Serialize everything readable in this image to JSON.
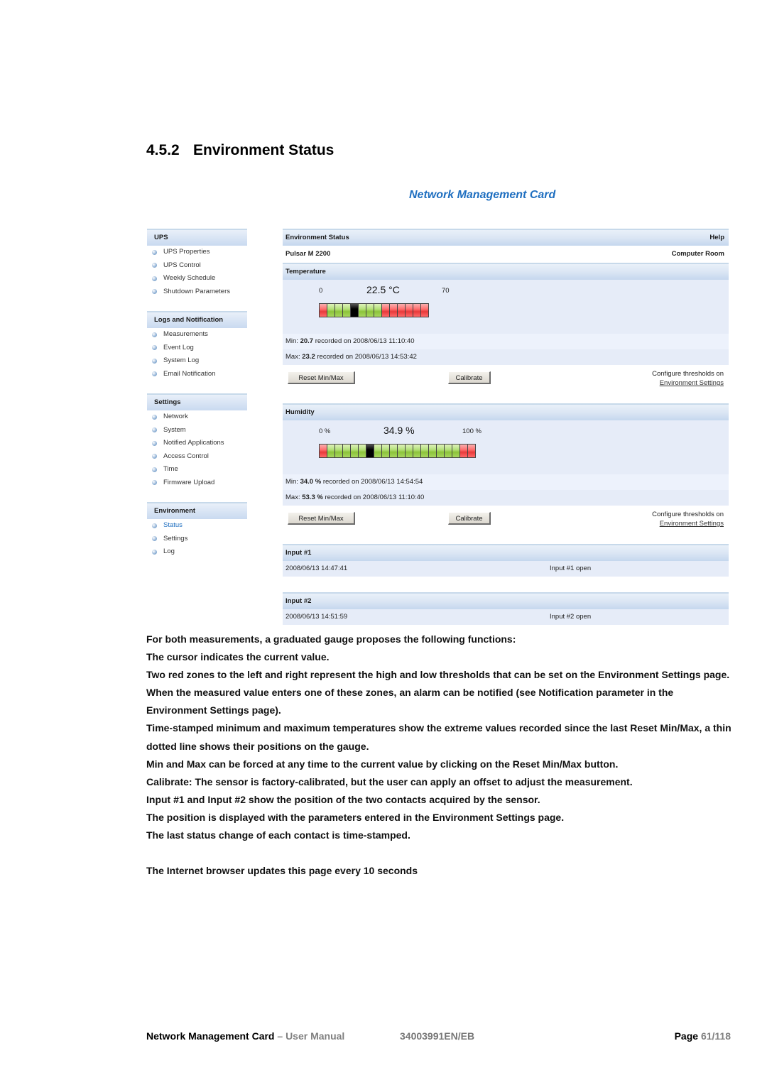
{
  "document": {
    "section_number": "4.5.2",
    "section_title": "Environment Status"
  },
  "screenshot": {
    "app_title": "Network Management Card",
    "sidebar": {
      "groups": [
        {
          "title": "UPS",
          "items": [
            "UPS Properties",
            "UPS Control",
            "Weekly Schedule",
            "Shutdown Parameters"
          ]
        },
        {
          "title": "Logs and Notification",
          "items": [
            "Measurements",
            "Event Log",
            "System Log",
            "Email Notification"
          ]
        },
        {
          "title": "Settings",
          "items": [
            "Network",
            "System",
            "Notified Applications",
            "Access Control",
            "Time",
            "Firmware Upload"
          ]
        },
        {
          "title": "Environment",
          "items": [
            "Status",
            "Settings",
            "Log"
          ],
          "active_item": "Status"
        }
      ]
    },
    "main": {
      "header_title": "Environment Status",
      "help_label": "Help",
      "device_name": "Pulsar M 2200",
      "location": "Computer Room",
      "temperature": {
        "title": "Temperature",
        "scale_min": "0",
        "scale_max": "70",
        "current_value": "22.5 °C",
        "gauge_segments": [
          "red",
          "green",
          "green",
          "green",
          "cursor",
          "green",
          "green",
          "green",
          "red",
          "red",
          "red",
          "red",
          "red",
          "red"
        ],
        "min_label": "Min:",
        "min_value": "20.7",
        "min_recorded": "recorded on 2008/06/13 11:10:40",
        "max_label": "Max:",
        "max_value": "23.2",
        "max_recorded": "recorded on 2008/06/13 14:53:42",
        "reset_button": "Reset Min/Max",
        "calibrate_button": "Calibrate",
        "configure_text": "Configure thresholds on",
        "configure_link": "Environment Settings"
      },
      "humidity": {
        "title": "Humidity",
        "scale_min": "0 %",
        "scale_max": "100 %",
        "current_value": "34.9 %",
        "gauge_segments": [
          "red",
          "green",
          "green",
          "green",
          "green",
          "green",
          "cursor",
          "green",
          "green",
          "green",
          "green",
          "green",
          "green",
          "green",
          "green",
          "green",
          "green",
          "green",
          "red",
          "red"
        ],
        "min_label": "Min:",
        "min_value": "34.0 %",
        "min_recorded": "recorded on 2008/06/13 14:54:54",
        "max_label": "Max:",
        "max_value": "53.3 %",
        "max_recorded": "recorded on 2008/06/13 11:10:40",
        "reset_button": "Reset Min/Max",
        "calibrate_button": "Calibrate",
        "configure_text": "Configure thresholds on",
        "configure_link": "Environment Settings"
      },
      "input1": {
        "title": "Input #1",
        "timestamp": "2008/06/13 14:47:41",
        "state": "Input #1 open"
      },
      "input2": {
        "title": "Input #2",
        "timestamp": "2008/06/13 14:51:59",
        "state": "Input #2 open"
      }
    }
  },
  "body_paragraphs": [
    "For both measurements, a graduated gauge proposes the following functions:",
    "The cursor indicates the current value.",
    "Two red zones to the left and right represent the high and low thresholds that can be set on the Environment Settings page.",
    "When the measured value enters one of these zones, an alarm can be notified (see Notification parameter in the Environment Settings page).",
    "Time-stamped minimum and maximum temperatures show the extreme values recorded since the last Reset Min/Max, a thin dotted line shows their positions on the gauge.",
    "Min and Max can be forced at any time to the current value by clicking on the Reset Min/Max button.",
    "Calibrate: The sensor is factory-calibrated, but the user can apply an offset to adjust the measurement.",
    "Input #1 and Input #2 show the position of the two contacts acquired by the sensor.",
    "The position is displayed with the parameters entered in the Environment Settings page.",
    "The last status change of each contact is time-stamped."
  ],
  "refresh_note": "The Internet browser updates this page every 10 seconds",
  "footer": {
    "product": "Network Management Card",
    "separator": " – ",
    "manual": "User Manual",
    "doc_number": "34003991EN/EB",
    "page_label": "Page",
    "page_number": "61/118"
  },
  "colors": {
    "brand_blue": "#1f6fc0",
    "gauge_red": "#e83a3a",
    "gauge_green": "#8cc43a",
    "panel_bg": "#e6ecf8"
  }
}
